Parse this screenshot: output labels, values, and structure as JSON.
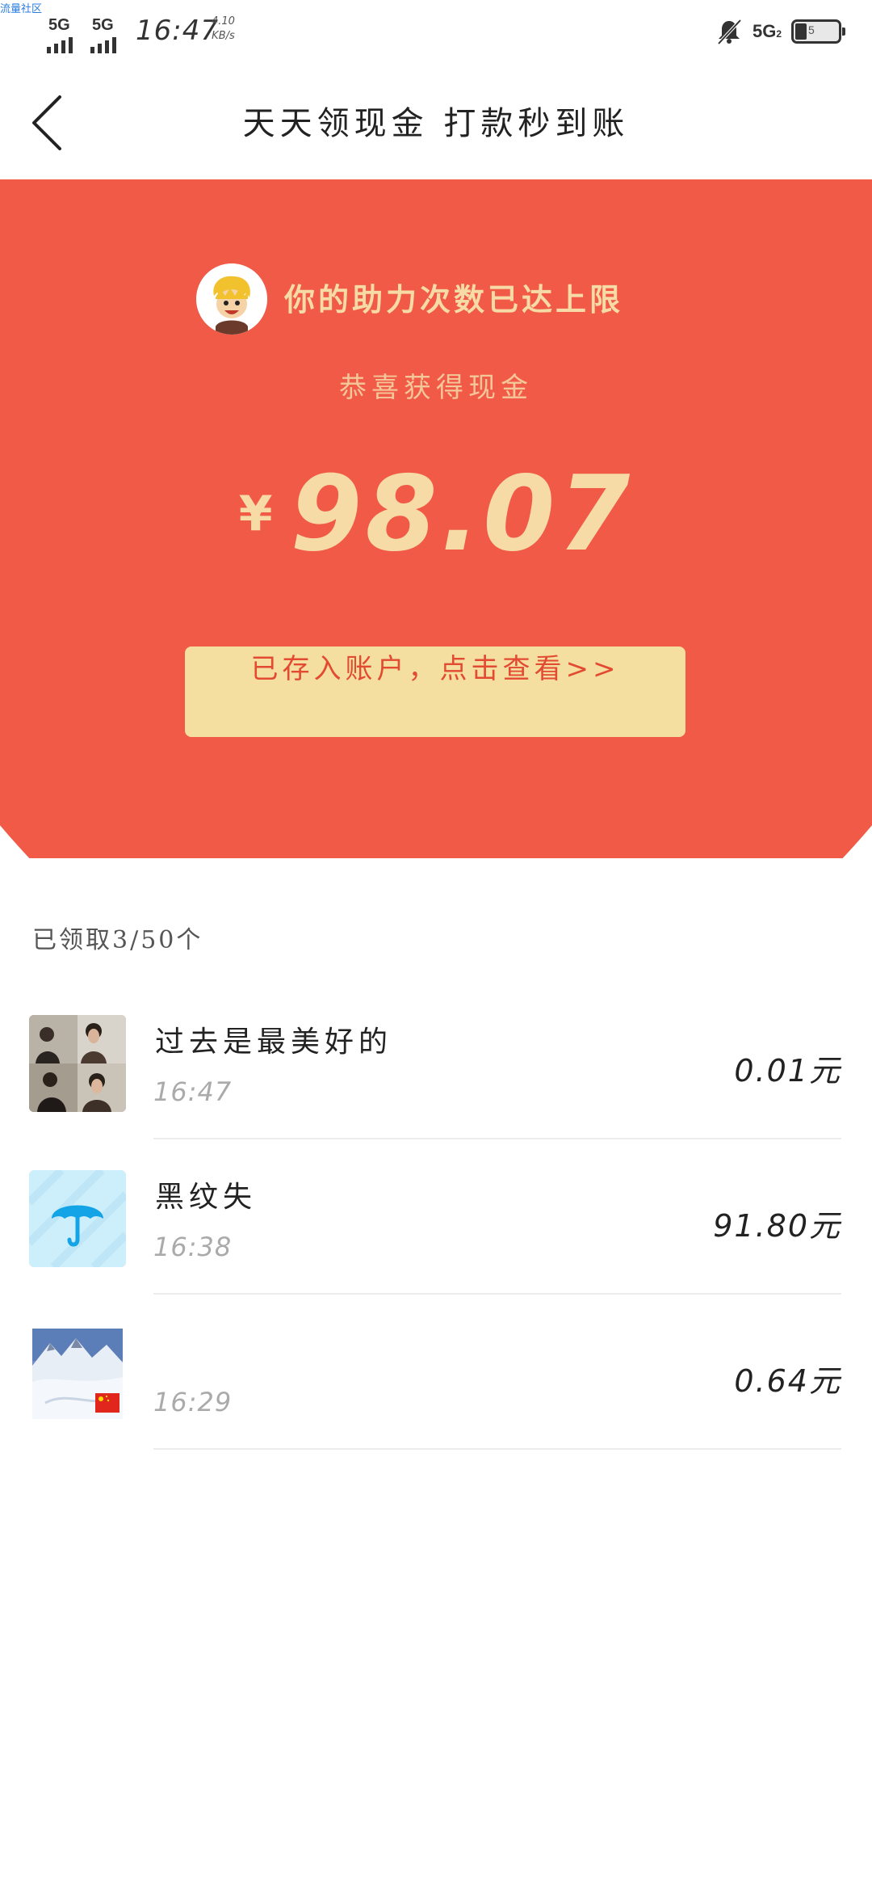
{
  "watermark": "流量社区",
  "status_bar": {
    "sim1_label": "5G",
    "sim2_label": "5G",
    "time": "16:47",
    "speed_value": "4.10",
    "speed_unit": "KB/s",
    "network_label": "5G",
    "network_sub": "2",
    "battery_level": "5"
  },
  "header": {
    "title": "天天领现金 打款秒到账"
  },
  "banner": {
    "limit_message": "你的助力次数已达上限",
    "congrats": "恭喜获得现金",
    "currency": "¥",
    "amount": "98.07",
    "deposit_button": "已存入账户，点击查看>>"
  },
  "claims": {
    "count_label": "已领取3/50个",
    "items": [
      {
        "name": "过去是最美好的",
        "time": "16:47",
        "amount": "0.01元",
        "avatar": "photo-couple"
      },
      {
        "name": "黑纹失",
        "time": "16:38",
        "amount": "91.80元",
        "avatar": "umbrella-icon"
      },
      {
        "name": "",
        "time": "16:29",
        "amount": "0.64元",
        "avatar": "photo-snow-mountain"
      }
    ]
  },
  "colors": {
    "banner_red": "#f05a46",
    "gold_text": "#f6dba6",
    "button_bg": "#f4dfa1",
    "button_text": "#e24a32"
  }
}
